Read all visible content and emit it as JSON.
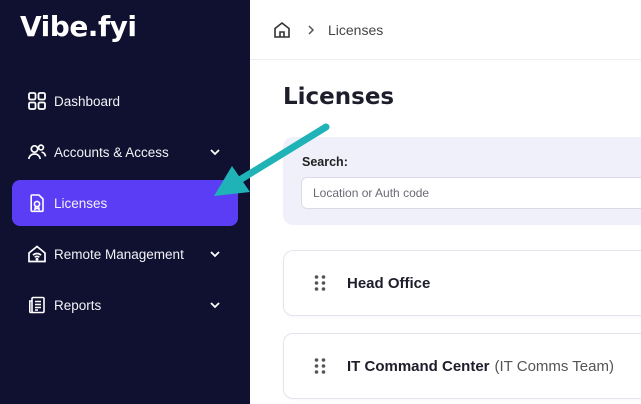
{
  "brand": {
    "logo_text": "Vibe.fyi"
  },
  "sidebar": {
    "items": [
      {
        "label": "Dashboard",
        "icon": "grid-icon",
        "expandable": false,
        "active": false
      },
      {
        "label": "Accounts & Access",
        "icon": "users-icon",
        "expandable": true,
        "active": false
      },
      {
        "label": "Licenses",
        "icon": "license-file-icon",
        "expandable": false,
        "active": true
      },
      {
        "label": "Remote Management",
        "icon": "wifi-home-icon",
        "expandable": true,
        "active": false
      },
      {
        "label": "Reports",
        "icon": "reports-icon",
        "expandable": true,
        "active": false
      }
    ]
  },
  "breadcrumb": {
    "home_icon": "home-icon",
    "current": "Licenses"
  },
  "page": {
    "title": "Licenses"
  },
  "search": {
    "label": "Search:",
    "placeholder": "Location or Auth code",
    "value": ""
  },
  "locations": [
    {
      "name": "Head Office",
      "team": ""
    },
    {
      "name": "IT Command Center",
      "team": "(IT Comms Team)"
    }
  ],
  "colors": {
    "sidebar_bg": "#101030",
    "active_bg": "#5b3df5",
    "accent_arrow": "#1fb3b8",
    "search_panel_bg": "#f0f0fb"
  }
}
